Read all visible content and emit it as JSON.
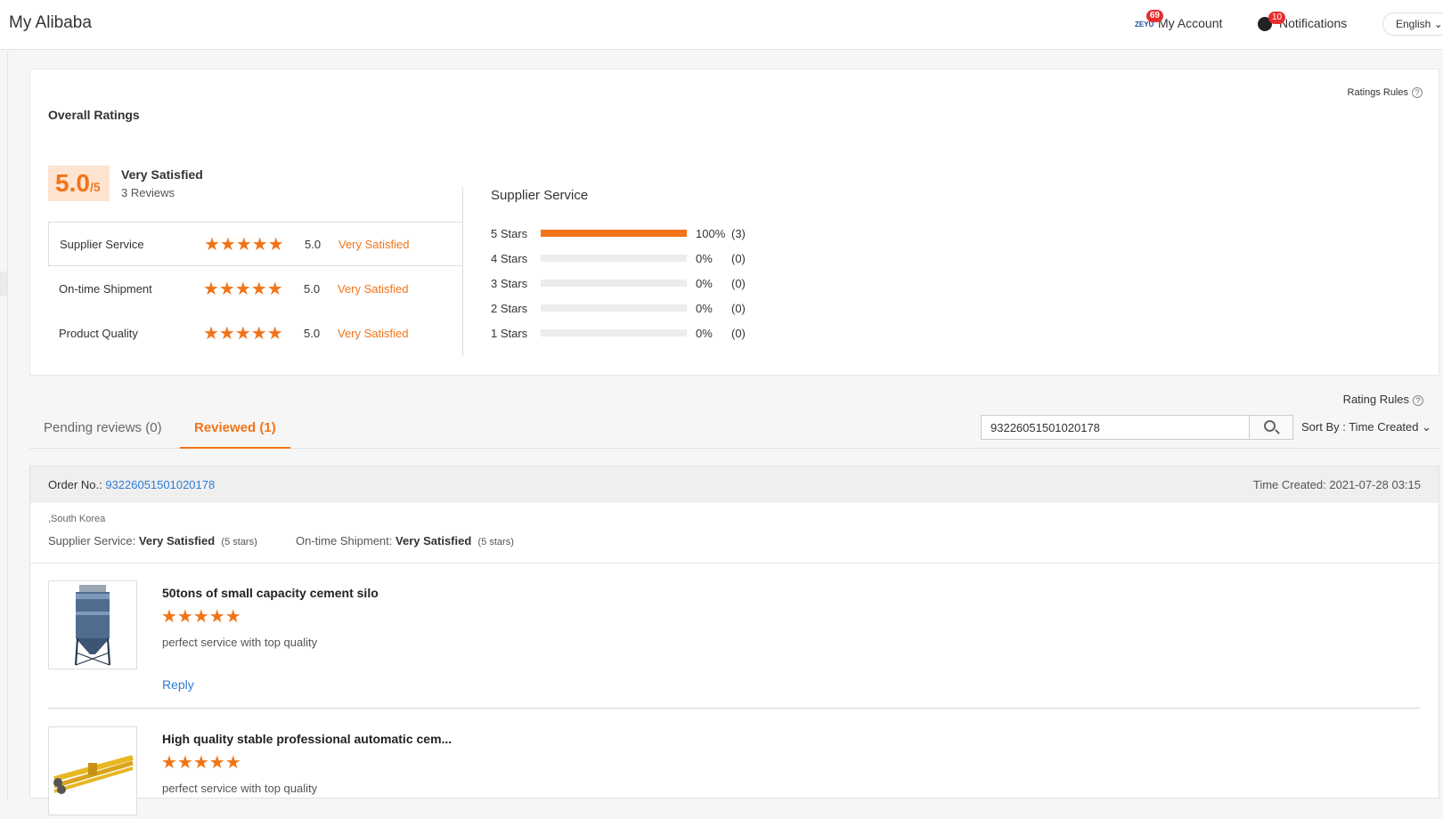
{
  "header": {
    "brand": "My Alibaba",
    "account_label": "My Account",
    "account_badge": "69",
    "account_logo_text": "ZEYU",
    "notifications_label": "Notifications",
    "notifications_badge": "10",
    "language": "English"
  },
  "overall": {
    "ratings_rules": "Ratings Rules",
    "title": "Overall Ratings",
    "score": "5.0",
    "score_max": "/5",
    "verdict": "Very Satisfied",
    "reviews": "3 Reviews",
    "metrics": [
      {
        "name": "Supplier Service",
        "value": "5.0",
        "verdict": "Very Satisfied",
        "stars": 5
      },
      {
        "name": "On-time Shipment",
        "value": "5.0",
        "verdict": "Very Satisfied",
        "stars": 5
      },
      {
        "name": "Product Quality",
        "value": "5.0",
        "verdict": "Very Satisfied",
        "stars": 5
      }
    ],
    "breakdown_title": "Supplier Service",
    "breakdown": [
      {
        "label": "5  Stars",
        "fill": 1.0,
        "pct": "100%",
        "count": "(3)"
      },
      {
        "label": "4  Stars",
        "fill": 0.0,
        "pct": "0%",
        "count": "(0)"
      },
      {
        "label": "3  Stars",
        "fill": 0.0,
        "pct": "0%",
        "count": "(0)"
      },
      {
        "label": "2  Stars",
        "fill": 0.0,
        "pct": "0%",
        "count": "(0)"
      },
      {
        "label": "1  Stars",
        "fill": 0.0,
        "pct": "0%",
        "count": "(0)"
      }
    ]
  },
  "reviews": {
    "rating_rules": "Rating Rules",
    "tabs": [
      "Pending reviews (0)",
      "Reviewed (1)"
    ],
    "search_value": "93226051501020178",
    "sort_label": "Sort By : Time Created",
    "order": {
      "order_label": "Order No.:",
      "order_no": "93226051501020178",
      "time_created": "Time Created: 2021-07-28 03:15",
      "location": ",South Korea",
      "supplier_service_label": "Supplier Service:",
      "supplier_service_value": "Very Satisfied",
      "supplier_service_stars": "(5 stars)",
      "shipment_label": "On-time Shipment:",
      "shipment_value": "Very Satisfied",
      "shipment_stars": "(5 stars)"
    },
    "items": [
      {
        "title": "50tons of small capacity cement silo",
        "comment": "perfect service with top quality",
        "reply": "Reply",
        "stars": 5
      },
      {
        "title": "High quality stable professional automatic cem...",
        "comment": "perfect service with top quality",
        "stars": 5
      }
    ]
  },
  "colors": {
    "accent": "#f27418",
    "link": "#2c7bd4"
  }
}
